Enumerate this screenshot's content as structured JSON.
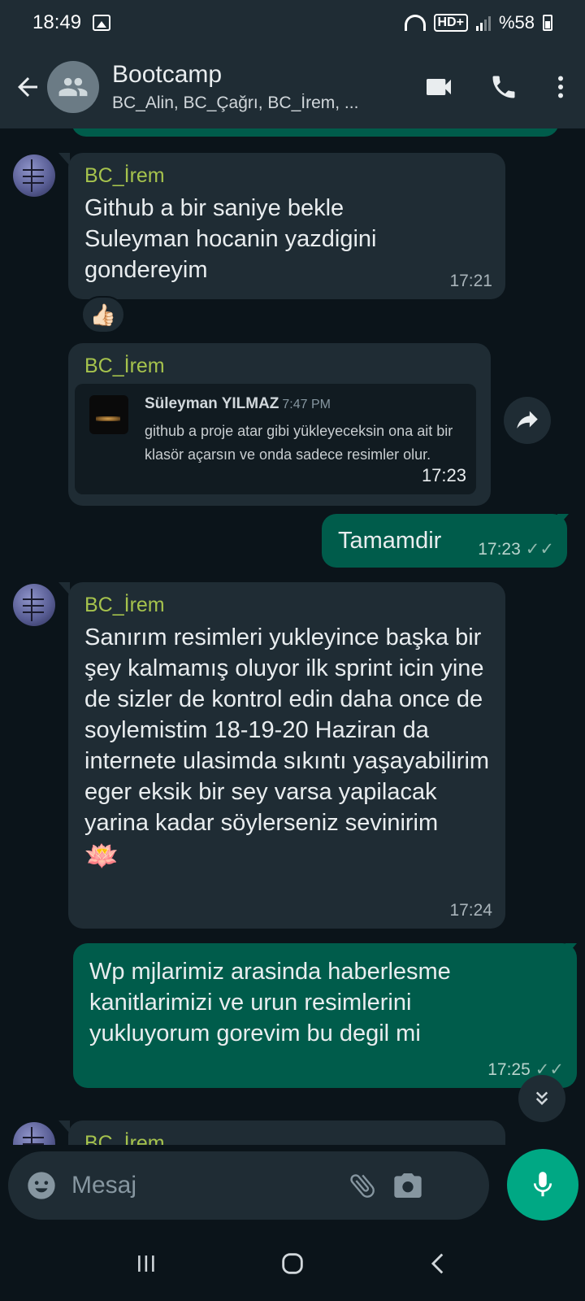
{
  "status_bar": {
    "time": "18:49",
    "network": "HD+",
    "battery": "%58"
  },
  "header": {
    "title": "Bootcamp",
    "members": "BC_Alin, BC_Çağrı, BC_İrem, ...",
    "icons": [
      "back-arrow-icon",
      "group-avatar-icon",
      "video-call-icon",
      "phone-icon",
      "more-vert-icon"
    ]
  },
  "messages": [
    {
      "direction": "in",
      "sender": "BC_İrem",
      "text": "Github a bir saniye bekle Suleyman hocanin yazdigini gondereyim",
      "time": "17:21",
      "reaction": "👍🏻"
    },
    {
      "direction": "in",
      "sender": "BC_İrem",
      "quoted": {
        "name": "Süleyman YILMAZ",
        "time": "7:47 PM",
        "text": "github a proje atar gibi yükleyeceksin ona ait bir klasör açarsın ve onda sadece resimler olur."
      },
      "time": "17:23"
    },
    {
      "direction": "out",
      "text": "Tamamdir",
      "time": "17:23",
      "status": "read"
    },
    {
      "direction": "in",
      "sender": "BC_İrem",
      "text": "Sanırım resimleri yukleyince başka bir şey kalmamış oluyor ilk sprint icin yine de sizler de kontrol edin daha once de soylemistim 18-19-20 Haziran da internete ulasimda sıkıntı yaşayabilirim eger eksik bir sey varsa yapilacak yarina kadar söylerseniz sevinirim",
      "emoji": "🪷",
      "time": "17:24"
    },
    {
      "direction": "out",
      "text": "Wp mjlarimiz arasinda haberlesme kanitlarimizi ve urun resimlerini yukluyorum gorevim bu degil mi",
      "time": "17:25",
      "status": "read"
    },
    {
      "direction": "in",
      "sender": "BC_İrem",
      "partial": true
    }
  ],
  "composer": {
    "placeholder": "Mesaj"
  },
  "colors": {
    "background": "#0b141a",
    "incoming_bubble": "#1f2c34",
    "outgoing_bubble": "#005c4b",
    "sender_name": "#a6c34d",
    "accent": "#00a884"
  }
}
